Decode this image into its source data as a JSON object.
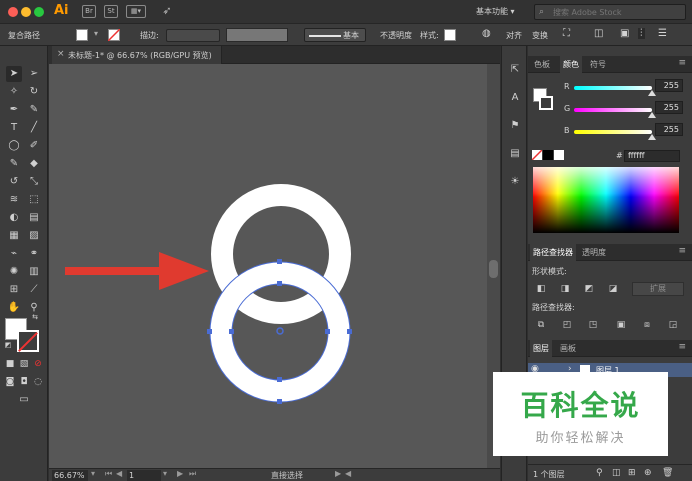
{
  "titlebar": {
    "app_logo": "Ai",
    "icon_br": "Br",
    "icon_st": "St",
    "workspace": "基本功能",
    "workspace_arrow": "▾",
    "search_placeholder": "搜索 Adobe Stock"
  },
  "controlbar": {
    "selection_type": "复合路径",
    "stroke_label": "描边:",
    "stroke_style": "基本",
    "opacity_label": "不透明度",
    "style_label": "样式:",
    "align": "对齐",
    "transform": "变换"
  },
  "document": {
    "tab_close": "×",
    "tab_title": "未标题-1* @ 66.67% (RGB/GPU 预览)"
  },
  "statusbar": {
    "zoom": "66.67%",
    "page": "1",
    "tool": "直接选择"
  },
  "color_panel": {
    "tabs": [
      "色板",
      "颜色",
      "符号"
    ],
    "channels": [
      {
        "label": "R",
        "value": "255"
      },
      {
        "label": "G",
        "value": "255"
      },
      {
        "label": "B",
        "value": "255"
      }
    ],
    "hex_symbol": "#",
    "hex": "ffffff"
  },
  "pathfinder_panel": {
    "tabs": [
      "路径查找器",
      "透明度"
    ],
    "shape_modes_label": "形状模式:",
    "pathfinders_label": "路径查找器:",
    "expand": "扩展"
  },
  "layers_panel": {
    "tabs": [
      "图层",
      "画板"
    ],
    "layer_name": "图层 1",
    "layer_count": "1 个图层"
  },
  "watermark": {
    "title": "百科全说",
    "subtitle": "助你轻松解决"
  },
  "colors": {
    "canvas": "#575757",
    "arrow": "#e03a2f",
    "selection": "#4a6cd4",
    "ring": "#ffffff",
    "watermark_green": "#35a84a"
  }
}
